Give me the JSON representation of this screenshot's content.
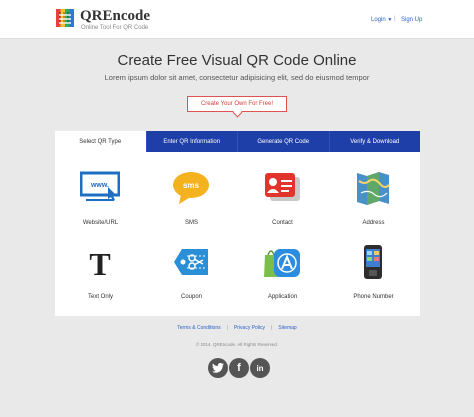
{
  "header": {
    "brand": "QREncode",
    "tagline": "Online Tool For QR Code",
    "login": "Login",
    "separator": "|",
    "signup": "Sign Up"
  },
  "hero": {
    "title": "Create Free Visual QR Code Online",
    "subtitle": "Lorem ipsum dolor sit amet, consectetur adipisicing elit, sed do eiusmod tempor",
    "cta": "Create Your Own For Free!"
  },
  "tabs": [
    {
      "label": "Select QR Type",
      "active": true
    },
    {
      "label": "Enter QR Information",
      "active": false
    },
    {
      "label": "Generate QR Code",
      "active": false
    },
    {
      "label": "Verify & Download",
      "active": false
    }
  ],
  "qr_types": [
    {
      "label": "Website/URL",
      "icon": "monitor-url-icon"
    },
    {
      "label": "SMS",
      "icon": "sms-bubble-icon"
    },
    {
      "label": "Contact",
      "icon": "contact-card-icon"
    },
    {
      "label": "Address",
      "icon": "map-icon"
    },
    {
      "label": "Text Only",
      "icon": "text-t-icon"
    },
    {
      "label": "Coupon",
      "icon": "coupon-scissors-icon"
    },
    {
      "label": "Application",
      "icon": "app-store-icon"
    },
    {
      "label": "Phone Number",
      "icon": "phone-icon"
    }
  ],
  "footer": {
    "links": [
      "Terms & Conditions",
      "Privacy Policy",
      "Sitemap"
    ],
    "link_separator": "|",
    "copyright": "© 2014. QREncode. All Rights Reserved.",
    "social": [
      {
        "name": "twitter",
        "icon": "twitter-icon"
      },
      {
        "name": "facebook",
        "icon": "facebook-icon",
        "glyph": "f"
      },
      {
        "name": "linkedin",
        "icon": "linkedin-icon",
        "glyph": "in"
      }
    ]
  },
  "colors": {
    "tab_blue": "#1f3fa8",
    "accent_red": "#d23c3c",
    "link_blue": "#2a5fc4",
    "page_bg": "#e9e9e9"
  }
}
